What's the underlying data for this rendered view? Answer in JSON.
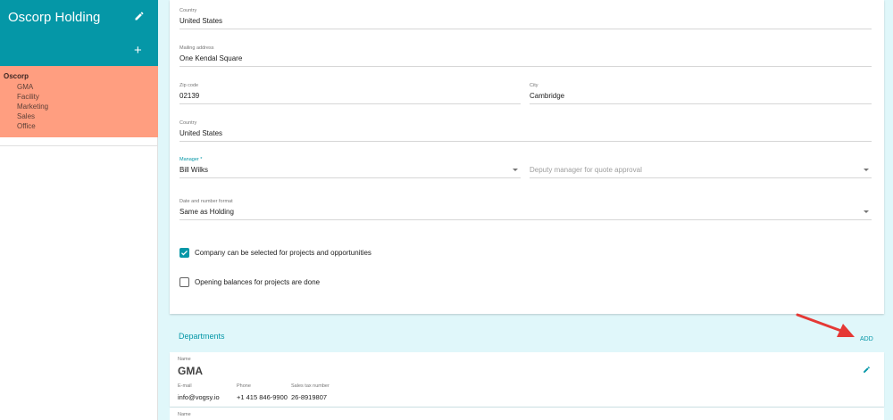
{
  "sidebar": {
    "title": "Oscorp Holding",
    "edit_icon": "pencil-icon",
    "add_icon": "plus-icon",
    "add_symbol": "+",
    "header_color": "#0597a7",
    "tree_color": "#ff9e80",
    "tree": {
      "root": "Oscorp",
      "children": [
        "GMA",
        "Facility",
        "Marketing",
        "Sales",
        "Office"
      ]
    }
  },
  "form": {
    "country_top": {
      "label": "Country",
      "value": "United States"
    },
    "mailing_address": {
      "label": "Mailing address",
      "value": "One Kendal Square"
    },
    "zip": {
      "label": "Zip code",
      "value": "02139"
    },
    "city": {
      "label": "City",
      "value": "Cambridge"
    },
    "country": {
      "label": "Country",
      "value": "United States"
    },
    "manager": {
      "label": "Manager *",
      "value": "Bill Wilks"
    },
    "deputy_manager": {
      "placeholder": "Deputy manager for quote approval"
    },
    "date_format": {
      "label": "Date and number format",
      "value": "Same as Holding"
    },
    "checkbox_selectable": {
      "label": "Company can be selected for projects and opportunities",
      "checked": true
    },
    "checkbox_opening": {
      "label": "Opening balances for projects are done",
      "checked": false
    }
  },
  "departments": {
    "title": "Departments",
    "add_label": "ADD",
    "items": [
      {
        "name_label": "Name",
        "name": "GMA",
        "email_label": "E-mail",
        "email": "info@vogsy.io",
        "phone_label": "Phone",
        "phone": "+1 415 846-9900",
        "tax_label": "Sales tax number",
        "tax": "26-8919807"
      },
      {
        "name_label": "Name"
      }
    ]
  },
  "colors": {
    "accent": "#0597a7",
    "annotation_arrow": "#e53935"
  }
}
